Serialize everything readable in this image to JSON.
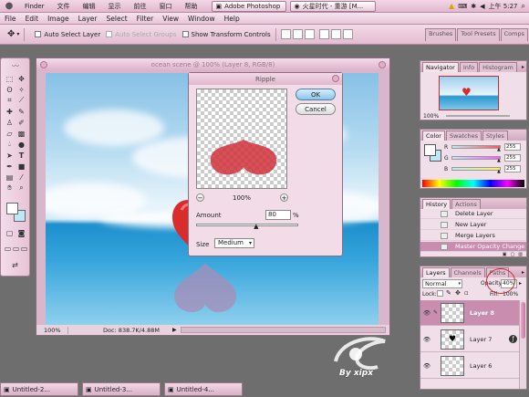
{
  "system_bar": {
    "menus": [
      "Finder",
      "文件",
      "编辑",
      "显示",
      "前往",
      "窗口",
      "帮助"
    ],
    "tasks": [
      {
        "label": "Adobe Photoshop"
      },
      {
        "label": "火星时代 - 重游 [M..."
      }
    ],
    "clock": "上午 5:27"
  },
  "menubar": [
    "File",
    "Edit",
    "Image",
    "Layer",
    "Select",
    "Filter",
    "View",
    "Window",
    "Help"
  ],
  "options_bar": {
    "auto_select_layer": "Auto Select Layer",
    "auto_select_groups": "Auto Select Groups",
    "show_transform_controls": "Show Transform Controls",
    "right_tabs": [
      "Brushes",
      "Tool Presets",
      "Comps"
    ]
  },
  "document": {
    "title": "ocean scene @ 100% (Layer 8, RGB/8)",
    "zoom": "100%",
    "doc_size": "Doc: 838.7K/4.88M"
  },
  "ripple_dialog": {
    "title": "Ripple",
    "ok": "OK",
    "cancel": "Cancel",
    "zoom": "100%",
    "amount_label": "Amount",
    "amount_value": "80",
    "amount_unit": "%",
    "amount_fraction": 0.59,
    "size_label": "Size",
    "size_value": "Medium"
  },
  "navigator": {
    "tabs": [
      "Navigator",
      "Info",
      "Histogram"
    ],
    "zoom": "100%"
  },
  "color": {
    "tabs": [
      "Color",
      "Swatches",
      "Styles"
    ],
    "channels": [
      {
        "label": "R",
        "value": "255",
        "color": "#ff5555",
        "level": 1.0
      },
      {
        "label": "G",
        "value": "255",
        "color": "#ff55ff",
        "level": 1.0
      },
      {
        "label": "B",
        "value": "255",
        "color": "#ffee55",
        "level": 1.0
      }
    ]
  },
  "history": {
    "tabs": [
      "History",
      "Actions"
    ],
    "items": [
      "Delete Layer",
      "New Layer",
      "Merge Layers",
      "Master Opacity Change"
    ]
  },
  "layers": {
    "tabs": [
      "Layers",
      "Channels",
      "Paths"
    ],
    "blend_mode": "Normal",
    "opacity_label": "Opacity:",
    "opacity_value": "40%",
    "lock_label": "Lock:",
    "fill_label": "Fill:",
    "fill_value": "100%",
    "items": [
      {
        "name": "Layer 8",
        "selected": true
      },
      {
        "name": "Layer 7",
        "selected": false
      },
      {
        "name": "Layer 6",
        "selected": false
      }
    ]
  },
  "minimized_docs": [
    "Untitled-2...",
    "Untitled-3...",
    "Untitled-4..."
  ],
  "watermark": "By xipx",
  "accent_color": "#e8c0d5"
}
